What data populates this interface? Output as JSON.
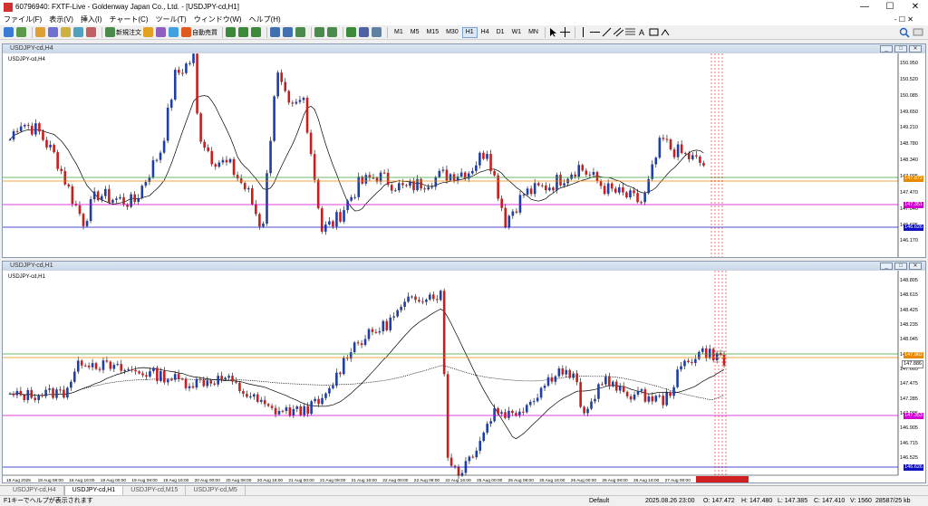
{
  "window": {
    "title": "60796940: FXTF-Live - Goldenway Japan Co., Ltd. - [USDJPY-cd,H1]",
    "minimize": "—",
    "maximize": "☐",
    "close": "✕"
  },
  "menu": {
    "items": [
      "ファイル(F)",
      "表示(V)",
      "挿入(I)",
      "チャート(C)",
      "ツール(T)",
      "ウィンドウ(W)",
      "ヘルプ(H)"
    ],
    "right": "- ☐ ✕"
  },
  "toolbar": {
    "new_order": "新規注文",
    "auto_trade": "自動売買",
    "timeframes": [
      "M1",
      "M5",
      "M15",
      "M30",
      "H1",
      "H4",
      "D1",
      "W1",
      "MN"
    ],
    "active_timeframe": "H1"
  },
  "colors": {
    "bull": "#1f3fa8",
    "bear": "#c81e1e",
    "ma": "#000000",
    "orange": "#e88a00",
    "green": "#3aa03a",
    "magenta": "#d000d0",
    "blue_line": "#1010c0",
    "red_vline": "#e02020"
  },
  "chart_top": {
    "window_title": "USDJPY-cd,H4",
    "symbol_label": "USDJPY-cd,H4",
    "price_labels": [
      "150.950",
      "150.520",
      "150.085",
      "149.650",
      "149.210",
      "148.780",
      "148.340",
      "147.905",
      "147.470",
      "147.040",
      "146.605",
      "146.170"
    ],
    "tags": [
      {
        "text": "147.872",
        "bg": "#e88a00"
      },
      {
        "text": "147.351",
        "bg": "#d000d0"
      },
      {
        "text": "146.626",
        "bg": "#1010c0"
      }
    ]
  },
  "chart_bottom": {
    "window_title": "USDJPY-cd,H1",
    "symbol_label": "USDJPY-cd,H1",
    "price_labels": [
      "148.805",
      "148.615",
      "148.425",
      "148.235",
      "148.045",
      "147.855",
      "147.665",
      "147.475",
      "147.285",
      "147.095",
      "146.905",
      "146.715",
      "146.525"
    ],
    "tags": [
      {
        "text": "147.962",
        "bg": "#e88a00"
      },
      {
        "text": "147.886",
        "bg": "#ffffff"
      },
      {
        "text": "147.353",
        "bg": "#d000d0"
      },
      {
        "text": "146.626",
        "bg": "#1010c0"
      }
    ],
    "time_labels": [
      "18 Aug 2025",
      "18 Aug 08:00",
      "18 Aug 16:00",
      "19 Aug 00:00",
      "19 Aug 08:00",
      "19 Aug 16:00",
      "20 Aug 00:00",
      "20 Aug 08:00",
      "20 Aug 16:00",
      "21 Aug 00:00",
      "21 Aug 08:00",
      "21 Aug 16:00",
      "22 Aug 00:00",
      "22 Aug 08:00",
      "22 Aug 16:00",
      "25 Aug 00:00",
      "25 Aug 08:00",
      "25 Aug 16:00",
      "26 Aug 00:00",
      "26 Aug 08:00",
      "26 Aug 16:00",
      "27 Aug 00:00",
      "27 Aug 08:00"
    ]
  },
  "tabs": [
    "USDJPY-cd,H4",
    "USDJPY-cd,H1",
    "USDJPY-cd,M15",
    "USDJPY-cd,M5"
  ],
  "active_tab": "USDJPY-cd,H1",
  "status": {
    "help": "F1キーでヘルプが表示されます",
    "profile": "Default",
    "datetime": "2025.08.26 23:00",
    "open": "O: 147.472",
    "high": "H: 147.480",
    "low": "L: 147.385",
    "close": "C: 147.410",
    "volume": "V: 1560",
    "traffic": "28587/25 kb"
  }
}
